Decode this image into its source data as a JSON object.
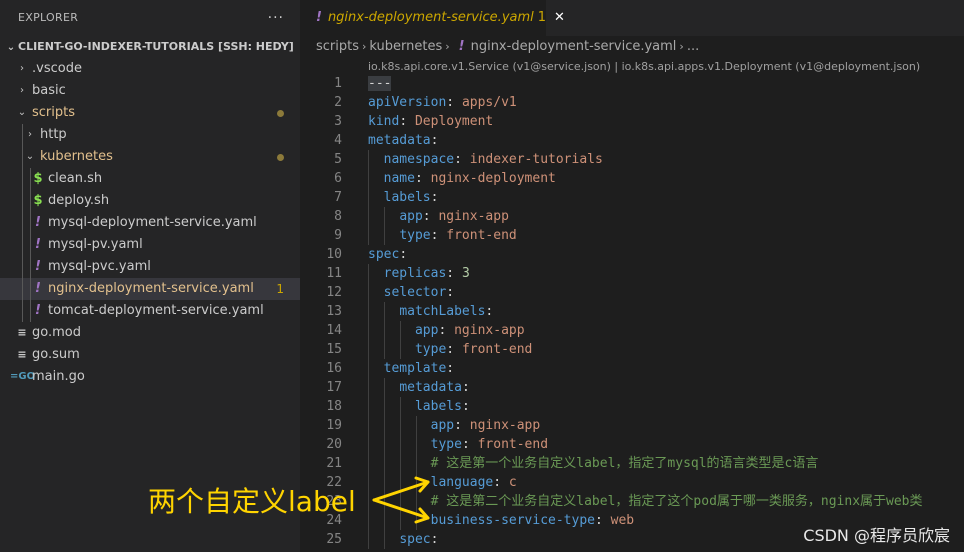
{
  "explorer": {
    "title": "EXPLORER",
    "more": "···",
    "section": "CLIENT-GO-INDEXER-TUTORIALS [SSH: HEDY]",
    "items": [
      {
        "label": "scripts",
        "badge": ""
      },
      {
        "label": ".vscode"
      },
      {
        "label": "basic"
      },
      {
        "label": "http"
      },
      {
        "label": "kubernetes"
      },
      {
        "label": "clean.sh"
      },
      {
        "label": "deploy.sh"
      },
      {
        "label": "mysql-deployment-service.yaml"
      },
      {
        "label": "mysql-pv.yaml"
      },
      {
        "label": "mysql-pvc.yaml"
      },
      {
        "label": "nginx-deployment-service.yaml",
        "badge": "1"
      },
      {
        "label": "tomcat-deployment-service.yaml"
      },
      {
        "label": "go.mod"
      },
      {
        "label": "go.sum"
      },
      {
        "label": "main.go"
      }
    ]
  },
  "tab": {
    "name": "nginx-deployment-service.yaml",
    "badge": "1",
    "close": "✕",
    "icon": "!"
  },
  "breadcrumb": {
    "scripts": "scripts",
    "kubernetes": "kubernetes",
    "file": "nginx-deployment-service.yaml",
    "ellipsis": "..."
  },
  "schema": "io.k8s.api.core.v1.Service (v1@service.json) | io.k8s.api.apps.v1.Deployment (v1@deployment.json)",
  "code": {
    "l1": "---",
    "l2k": "apiVersion",
    "l2v": "apps/v1",
    "l3k": "kind",
    "l3v": "Deployment",
    "l4k": "metadata",
    "l5k": "namespace",
    "l5v": "indexer-tutorials",
    "l6k": "name",
    "l6v": "nginx-deployment",
    "l7k": "labels",
    "l8k": "app",
    "l8v": "nginx-app",
    "l9k": "type",
    "l9v": "front-end",
    "l10k": "spec",
    "l11k": "replicas",
    "l11v": "3",
    "l12k": "selector",
    "l13k": "matchLabels",
    "l14k": "app",
    "l14v": "nginx-app",
    "l15k": "type",
    "l15v": "front-end",
    "l16k": "template",
    "l17k": "metadata",
    "l18k": "labels",
    "l19k": "app",
    "l19v": "nginx-app",
    "l20k": "type",
    "l20v": "front-end",
    "l21c": "# 这是第一个业务自定义label，指定了mysql的语言类型是c语言",
    "l22k": "language",
    "l22v": "c",
    "l23c": "# 这是第二个业务自定义label，指定了这个pod属于哪一类服务，nginx属于web类",
    "l24k": "business-service-type",
    "l24v": "web",
    "l25k": "spec"
  },
  "annotation": "两个自定义label",
  "watermark": "CSDN @程序员欣宸",
  "colors": {
    "accent_modified": "#e2c08d",
    "yaml_icon": "#a074c4",
    "sh_icon": "#89e051",
    "go_icon": "#519aba",
    "annotation": "#ffd400"
  }
}
